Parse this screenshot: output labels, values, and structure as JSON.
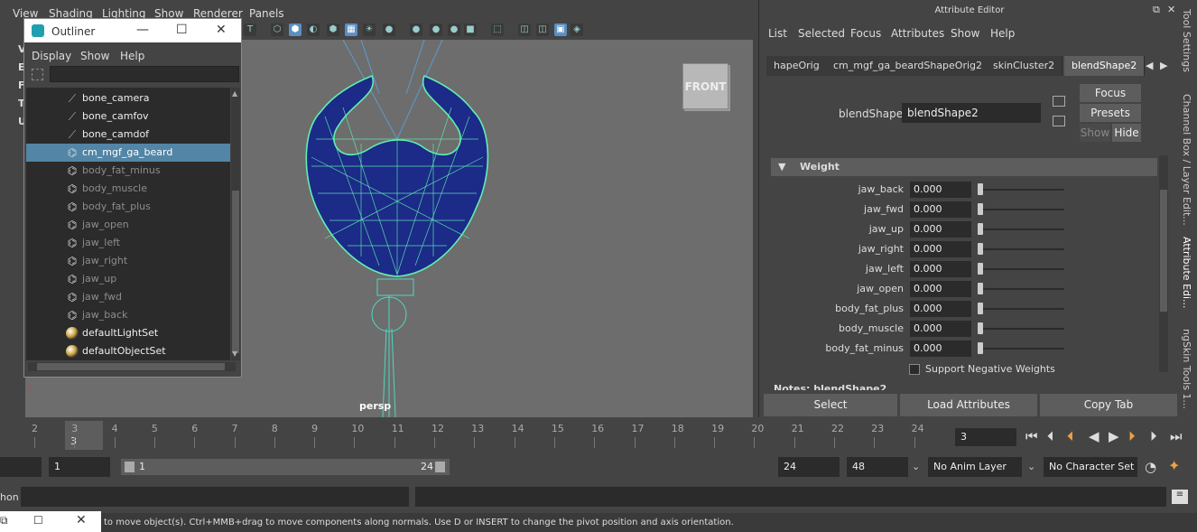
{
  "viewport": {
    "menu": [
      "View",
      "Shading",
      "Lighting",
      "Show",
      "Renderer",
      "Panels"
    ],
    "left_labels": [
      "V",
      "E",
      "F",
      "T",
      "U"
    ],
    "cube_label": "FRONT",
    "camera_label": "persp"
  },
  "outliner": {
    "title": "Outliner",
    "menu": [
      "Display",
      "Show",
      "Help"
    ],
    "items": [
      {
        "label": "bone_camera",
        "icon": "bone-icon",
        "state": "normal"
      },
      {
        "label": "bone_camfov",
        "icon": "bone-icon",
        "state": "normal"
      },
      {
        "label": "bone_camdof",
        "icon": "bone-icon",
        "state": "normal"
      },
      {
        "label": "cm_mgf_ga_beard",
        "icon": "mesh-icon",
        "state": "selected"
      },
      {
        "label": "body_fat_minus",
        "icon": "mesh-icon",
        "state": "dim"
      },
      {
        "label": "body_muscle",
        "icon": "mesh-icon",
        "state": "dim"
      },
      {
        "label": "body_fat_plus",
        "icon": "mesh-icon",
        "state": "dim"
      },
      {
        "label": "jaw_open",
        "icon": "mesh-icon",
        "state": "dim"
      },
      {
        "label": "jaw_left",
        "icon": "mesh-icon",
        "state": "dim"
      },
      {
        "label": "jaw_right",
        "icon": "mesh-icon",
        "state": "dim"
      },
      {
        "label": "jaw_up",
        "icon": "mesh-icon",
        "state": "dim"
      },
      {
        "label": "jaw_fwd",
        "icon": "mesh-icon",
        "state": "dim"
      },
      {
        "label": "jaw_back",
        "icon": "mesh-icon",
        "state": "dim"
      },
      {
        "label": "defaultLightSet",
        "icon": "set-icon",
        "state": "normal"
      },
      {
        "label": "defaultObjectSet",
        "icon": "set-icon",
        "state": "normal"
      }
    ]
  },
  "attribute_editor": {
    "title": "Attribute Editor",
    "menu": [
      "List",
      "Selected",
      "Focus",
      "Attributes",
      "Show",
      "Help"
    ],
    "tabs": [
      "hapeOrig",
      "cm_mgf_ga_beardShapeOrig2",
      "skinCluster2",
      "blendShape2"
    ],
    "active_tab": "blendShape2",
    "node_label": "blendShape:",
    "node_value": "blendShape2",
    "focus_label": "Focus",
    "presets_label": "Presets",
    "show_label": "Show",
    "hide_label": "Hide",
    "section": "Weight",
    "weights": [
      {
        "name": "jaw_back",
        "value": "0.000"
      },
      {
        "name": "jaw_fwd",
        "value": "0.000"
      },
      {
        "name": "jaw_up",
        "value": "0.000"
      },
      {
        "name": "jaw_right",
        "value": "0.000"
      },
      {
        "name": "jaw_left",
        "value": "0.000"
      },
      {
        "name": "jaw_open",
        "value": "0.000"
      },
      {
        "name": "body_fat_plus",
        "value": "0.000"
      },
      {
        "name": "body_muscle",
        "value": "0.000"
      },
      {
        "name": "body_fat_minus",
        "value": "0.000"
      }
    ],
    "support_negative": "Support Negative Weights",
    "notes": "Notes: blendShape2",
    "buttons": [
      "Select",
      "Load Attributes",
      "Copy Tab"
    ]
  },
  "side_tabs": [
    "Tool Settings",
    "Channel Box / Layer Edit...",
    "Attribute Edi...",
    "ngSkin Tools 1..."
  ],
  "timeline": {
    "ticks": [
      "2",
      "3",
      "4",
      "5",
      "6",
      "7",
      "8",
      "9",
      "10",
      "11",
      "12",
      "13",
      "14",
      "15",
      "16",
      "17",
      "18",
      "19",
      "20",
      "21",
      "22",
      "23",
      "24"
    ],
    "current_frame_marker": "3",
    "current_frame_field": "3"
  },
  "range": {
    "start": "1",
    "range_start": "1",
    "range_end": "24",
    "end": "24",
    "total_end": "48",
    "anim_layer": "No Anim Layer",
    "char_set": "No Character Set"
  },
  "command": {
    "label": "hon"
  },
  "help_line": "to move object(s). Ctrl+MMB+drag to move components along normals. Use D or INSERT to change the pivot position and axis orientation."
}
